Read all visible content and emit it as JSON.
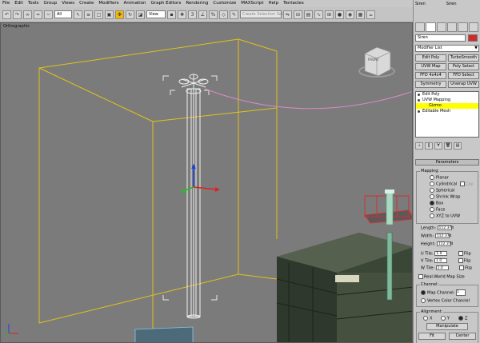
{
  "menu": [
    "File",
    "Edit",
    "Tools",
    "Group",
    "Views",
    "Create",
    "Modifiers",
    "Animation",
    "Graph Editors",
    "Rendering",
    "Customize",
    "MAXScript",
    "Help",
    "Tentacles"
  ],
  "toolbar": {
    "filter_value": "All",
    "refcoord_value": "View",
    "named_selection_placeholder": "Create Selection Set"
  },
  "viewport": {
    "label": "Orthographic",
    "viewcube_label": "FRONT"
  },
  "panel": {
    "tabs": [
      "Siren",
      "Siren"
    ],
    "object_name": "Siren",
    "swatch_color": "#d12a2a",
    "modifier_list_label": "Modifier List",
    "modifier_buttons": [
      "Edit Poly",
      "TurboSmooth",
      "UVW Map",
      "Poly Select",
      "FFD 4x4x4",
      "FFD Select",
      "Symmetry",
      "Unwrap UVW"
    ],
    "stack": [
      "Edit Poly",
      "UVW Mapping",
      "Gizmo",
      "Editable Mesh"
    ],
    "parameters_title": "Parameters",
    "mapping_title": "Mapping:",
    "mapping_options": [
      "Planar",
      "Cylindrical",
      "Cap",
      "Spherical",
      "Shrink Wrap",
      "Box",
      "Face",
      "XYZ to UVW"
    ],
    "mapping_selected": "Box",
    "length_label": "Length:",
    "length_value": "112.374",
    "width_label": "Width:",
    "width_value": "112.374",
    "height_label": "Height:",
    "height_value": "112.374",
    "utile_label": "U Tile:",
    "utile_value": "1.0",
    "vtile_label": "V Tile:",
    "vtile_value": "1.0",
    "wtile_label": "W Tile:",
    "wtile_value": "1.0",
    "flip_label": "Flip",
    "realworld_label": "Real-World Map Size",
    "channel_title": "Channel:",
    "map_channel_label": "Map Channel:",
    "map_channel_value": "1",
    "vertex_channel_label": "Vertex Color Channel",
    "alignment_title": "Alignment:",
    "axis_x": "X",
    "axis_y": "Y",
    "axis_z": "Z",
    "manipulate_label": "Manipulate",
    "fit_label": "Fit",
    "center_label": "Center"
  }
}
